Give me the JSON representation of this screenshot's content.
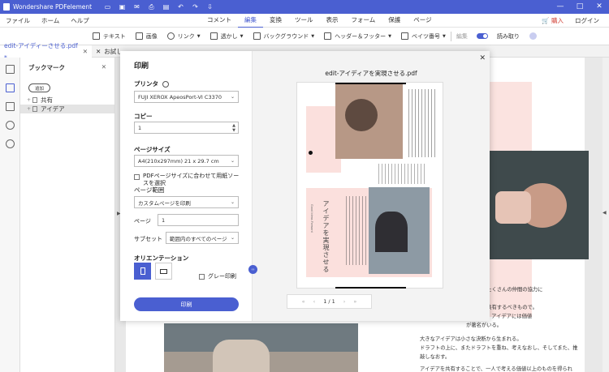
{
  "app": {
    "title": "Wondershare PDFelement",
    "window_controls": [
      "—",
      "□",
      "✕"
    ]
  },
  "menu": {
    "left": [
      "ファイル",
      "ホーム",
      "ヘルプ"
    ],
    "center": [
      "コメント",
      "編集",
      "変換",
      "ツール",
      "表示",
      "フォーム",
      "保護",
      "ページ"
    ],
    "active": "編集",
    "buy": "購入",
    "login": "ログイン"
  },
  "toolbar": {
    "text": "テキスト",
    "image": "画像",
    "link": "リンク",
    "watermark": "透かし",
    "background": "バックグラウンド",
    "header_footer": "ヘッダー＆フッター",
    "bates": "ベイツ番号",
    "edit": "編集",
    "readonly": "読み取り"
  },
  "tabs": {
    "active": "edit-アイディーさせる.pdf *",
    "other": "お試し"
  },
  "bookmark": {
    "title": "ブックマーク",
    "button": "追加",
    "items": [
      "共有",
      "アイデア"
    ]
  },
  "dialog": {
    "title": "印刷",
    "printer_label": "プリンタ",
    "printer_value": "FUJI XEROX ApeosPort-VI C3370",
    "copies_label": "コピー",
    "copies_value": "1",
    "page_size_label": "ページサイズ",
    "page_size_value": "A4(210x297mm) 21 x 29.7 cm",
    "fit_label": "PDFページサイズに合わせて用紙ソースを選択",
    "range_label": "ページ範囲",
    "range_value": "カスタムページを印刷",
    "page_label": "ページ",
    "page_value": "1",
    "subset_label": "サブセット",
    "subset_value": "範囲内のすべてのページ",
    "orientation_label": "オリエンテーション",
    "gray_label": "グレー印刷",
    "print_button": "印刷",
    "preview_title": "edit-アイディアを実現させる.pdf",
    "preview_vertical_title": "アイデアを実現させる",
    "preview_vertical_sub": "Good Ideas Forward",
    "pager": "1 / 1"
  },
  "background_doc": {
    "right_text": [
      "少なく、たくさんの仲間の協力に",
      "",
      "やすく、共有するべきもので。",
      "ましょう。アイデアには価値",
      "が著名がいる。"
    ],
    "lower_text": [
      "大きなアイデアは小さな決断から生まれる。",
      "ドラフトの上に、またドラフトを重ね、考えなおし、そしてまた、推",
      "敲しなおす。",
      "",
      "アイデアを共有することで、一人で考える価値以上のものを得られ"
    ]
  }
}
